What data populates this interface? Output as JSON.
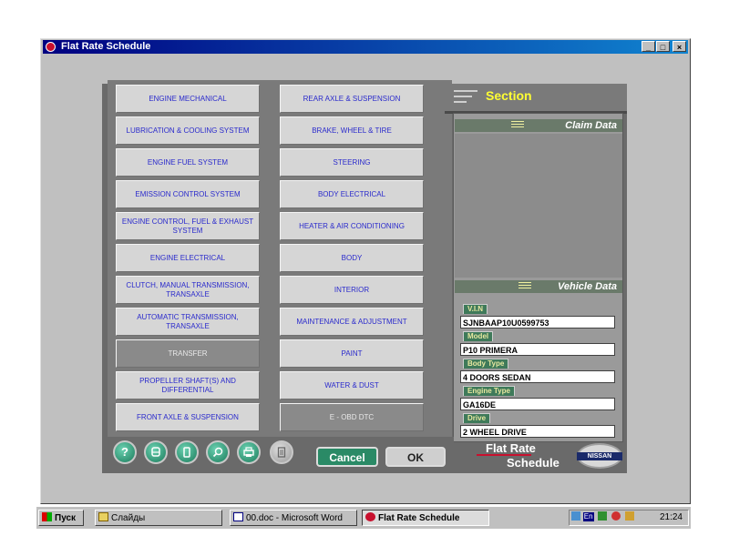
{
  "window": {
    "title": "Flat Rate Schedule",
    "min": "_",
    "max": "□",
    "close": "×"
  },
  "section": {
    "title": "Section"
  },
  "claim_data": {
    "title": "Claim Data"
  },
  "vehicle_data": {
    "title": "Vehicle Data",
    "fields": [
      {
        "label": "V.I.N",
        "value": "SJNBAAP10U0599753"
      },
      {
        "label": "Model",
        "value": "P10 PRIMERA"
      },
      {
        "label": "Body Type",
        "value": "4 DOORS SEDAN"
      },
      {
        "label": "Engine Type",
        "value": "GA16DE"
      },
      {
        "label": "Drive",
        "value": "2 WHEEL DRIVE"
      }
    ]
  },
  "left_column": [
    {
      "label": "ENGINE MECHANICAL"
    },
    {
      "label": "LUBRICATION & COOLING SYSTEM"
    },
    {
      "label": "ENGINE FUEL SYSTEM"
    },
    {
      "label": "EMISSION CONTROL SYSTEM"
    },
    {
      "label": "ENGINE CONTROL, FUEL & EXHAUST SYSTEM"
    },
    {
      "label": "ENGINE ELECTRICAL"
    },
    {
      "label": "CLUTCH, MANUAL TRANSMISSION, TRANSAXLE"
    },
    {
      "label": "AUTOMATIC TRANSMISSION, TRANSAXLE"
    },
    {
      "label": "TRANSFER"
    },
    {
      "label": "PROPELLER SHAFT(S) AND DIFFERENTIAL"
    },
    {
      "label": "FRONT AXLE & SUSPENSION"
    }
  ],
  "right_column": [
    {
      "label": "REAR AXLE & SUSPENSION"
    },
    {
      "label": "BRAKE, WHEEL & TIRE"
    },
    {
      "label": "STEERING"
    },
    {
      "label": "BODY ELECTRICAL"
    },
    {
      "label": "HEATER & AIR CONDITIONING"
    },
    {
      "label": "BODY"
    },
    {
      "label": "INTERIOR"
    },
    {
      "label": "MAINTENANCE & ADJUSTMENT"
    },
    {
      "label": "PAINT"
    },
    {
      "label": "WATER & DUST"
    },
    {
      "label": "E - OBD DTC"
    }
  ],
  "toolbar": {
    "help": "?",
    "cancel": "Cancel",
    "ok": "OK"
  },
  "brand": {
    "line1": "Flat Rate",
    "line2": "Schedule",
    "logo": "NISSAN"
  },
  "taskbar": {
    "start": "Пуск",
    "items": [
      "Слайды",
      "00.doc - Microsoft Word",
      "Flat Rate Schedule"
    ],
    "lang": "En",
    "clock": "21:24"
  },
  "colors": {
    "accent": "#3f7a5a",
    "section_title": "#ffff33",
    "button_text": "#2a2acc"
  }
}
